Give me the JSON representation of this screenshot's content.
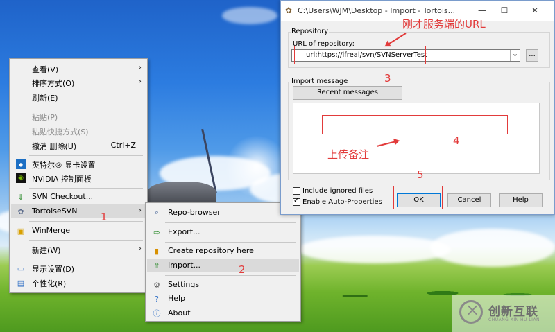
{
  "desktop_menu": {
    "items": [
      {
        "label": "查看(V)",
        "arrow": "›"
      },
      {
        "label": "排序方式(O)",
        "arrow": "›"
      },
      {
        "label": "刷新(E)"
      },
      {
        "label": "粘贴(P)"
      },
      {
        "label": "粘贴快捷方式(S)"
      },
      {
        "label": "撤消 删除(U)",
        "shortcut": "Ctrl+Z"
      },
      {
        "label": "英特尔® 显卡设置"
      },
      {
        "label": "NVIDIA 控制面板"
      },
      {
        "label": "SVN Checkout..."
      },
      {
        "label": "TortoiseSVN",
        "arrow": "›"
      },
      {
        "label": "WinMerge"
      },
      {
        "label": "新建(W)",
        "arrow": "›"
      },
      {
        "label": "显示设置(D)"
      },
      {
        "label": "个性化(R)"
      }
    ]
  },
  "svn_menu": {
    "items": [
      {
        "label": "Repo-browser"
      },
      {
        "label": "Export..."
      },
      {
        "label": "Create repository here"
      },
      {
        "label": "Import..."
      },
      {
        "label": "Settings"
      },
      {
        "label": "Help"
      },
      {
        "label": "About"
      }
    ]
  },
  "dialog": {
    "title": "C:\\Users\\WJM\\Desktop - Import - Tortois...",
    "minimize": "—",
    "maximize": "☐",
    "close": "✕",
    "repository_group": "Repository",
    "url_label": "URL of repository:",
    "url_value": "url:https://lfreal/svn/SVNServerTest",
    "dropdown_arrow": "⌄",
    "browse_label": "...",
    "import_group": "Import message",
    "recent_messages": "Recent messages",
    "include_ignored": "Include ignored files",
    "auto_props": "Enable Auto-Properties",
    "ok": "OK",
    "cancel": "Cancel",
    "help": "Help"
  },
  "annotations": {
    "n1": "1",
    "n2": "2",
    "n3": "3",
    "n4": "4",
    "n5": "5",
    "server_url": "刚才服务端的URL",
    "upload_note": "上传备注"
  },
  "watermark": {
    "name": "创新互联",
    "sub": "CHUANG XIN HU LIAN"
  },
  "colors": {
    "annotation": "#e23b3b",
    "menu_bg": "#f0f0f0",
    "menu_hover": "#dadada"
  }
}
